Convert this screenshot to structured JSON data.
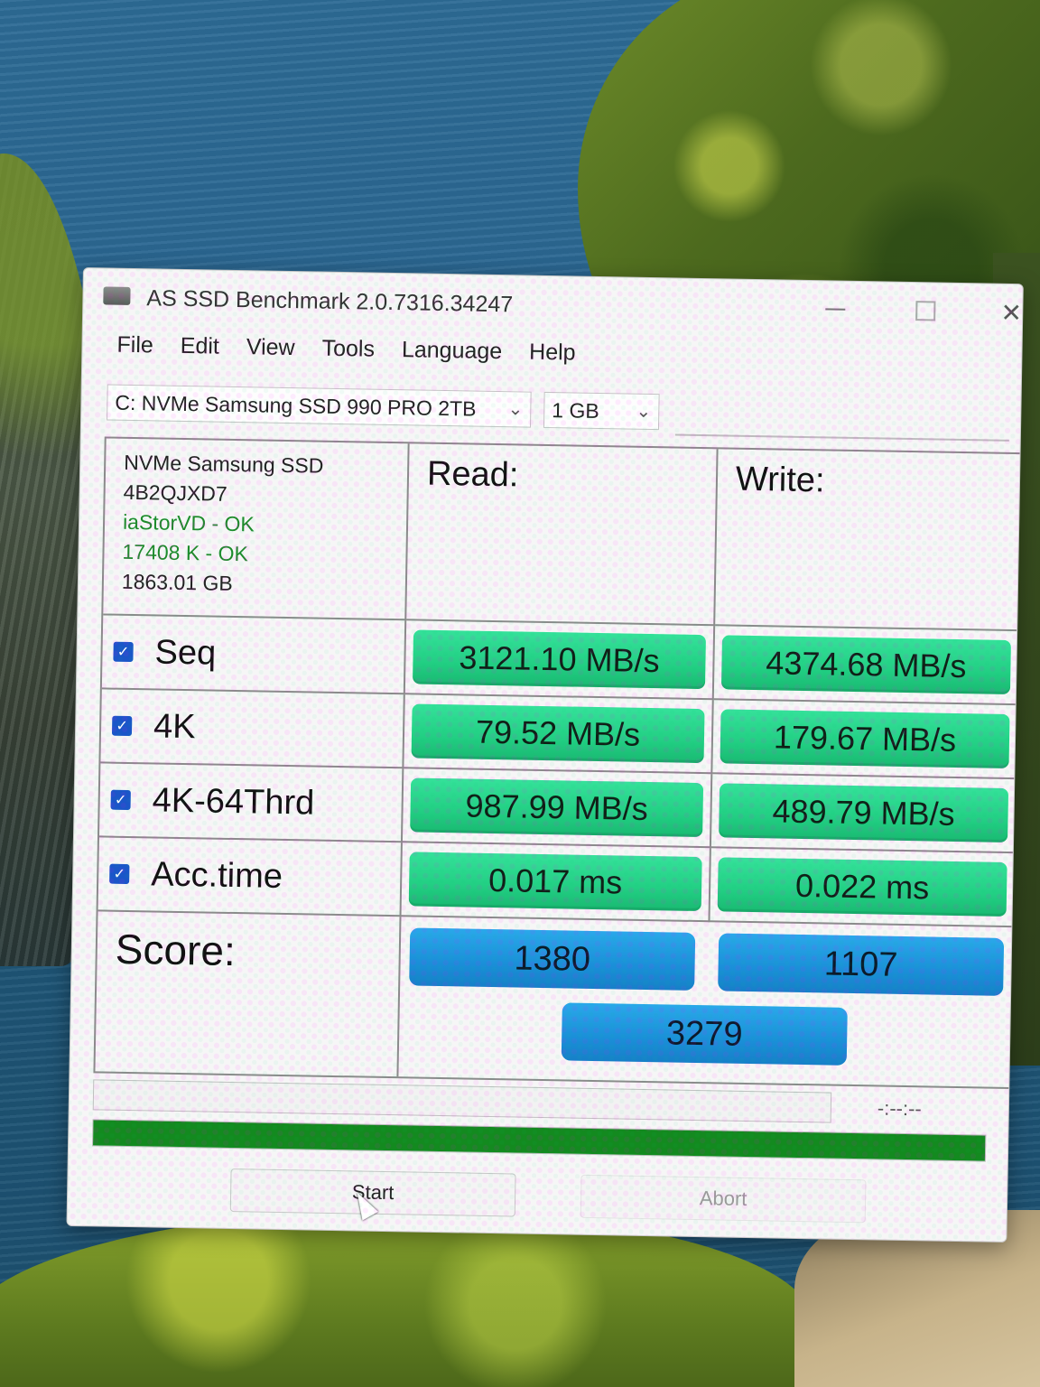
{
  "window": {
    "title": "AS SSD Benchmark 2.0.7316.34247"
  },
  "menu": [
    "File",
    "Edit",
    "View",
    "Tools",
    "Language",
    "Help"
  ],
  "drive_select": {
    "value": "C: NVMe Samsung SSD 990 PRO 2TB"
  },
  "size_select": {
    "value": "1 GB"
  },
  "drive_info": {
    "model": "NVMe Samsung SSD",
    "firmware": "4B2QJXD7",
    "driver": "iaStorVD - OK",
    "alignment": "17408 K - OK",
    "capacity": "1863.01 GB"
  },
  "columns": {
    "read": "Read:",
    "write": "Write:"
  },
  "rows": [
    {
      "label": "Seq",
      "checked": true,
      "read": "3121.10 MB/s",
      "write": "4374.68 MB/s"
    },
    {
      "label": "4K",
      "checked": true,
      "read": "79.52 MB/s",
      "write": "179.67 MB/s"
    },
    {
      "label": "4K-64Thrd",
      "checked": true,
      "read": "987.99 MB/s",
      "write": "489.79 MB/s"
    },
    {
      "label": "Acc.time",
      "checked": true,
      "read": "0.017 ms",
      "write": "0.022 ms"
    }
  ],
  "score": {
    "label": "Score:",
    "read": "1380",
    "write": "1107",
    "total": "3279"
  },
  "status": {
    "time": "-:--:--"
  },
  "progress": {
    "fraction": 1.0
  },
  "buttons": {
    "start": "Start",
    "abort": "Abort"
  },
  "colors": {
    "result_bar": "#22cf83",
    "score_bar": "#1a8fd8",
    "progress_fill": "#138a1f",
    "checkbox": "#1a56c8"
  }
}
